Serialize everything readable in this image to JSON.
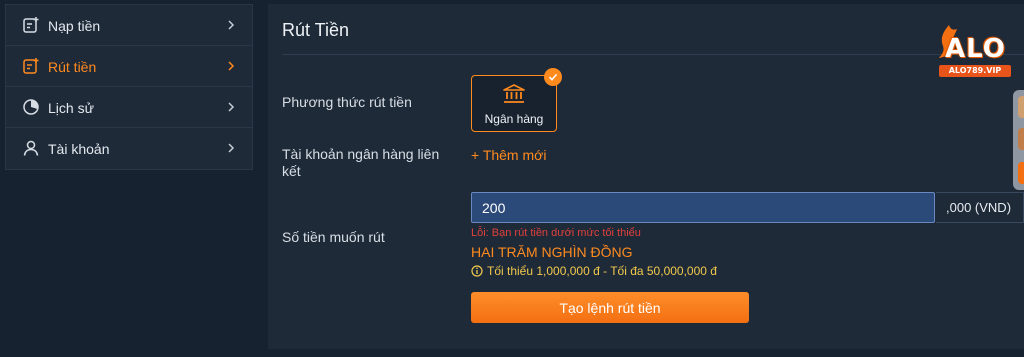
{
  "sidebar": {
    "items": [
      {
        "label": "Nạp tiền",
        "icon": "deposit-icon",
        "active": false
      },
      {
        "label": "Rút tiền",
        "icon": "withdraw-icon",
        "active": true
      },
      {
        "label": "Lịch sử",
        "icon": "history-icon",
        "active": false
      },
      {
        "label": "Tài khoản",
        "icon": "user-icon",
        "active": false
      }
    ]
  },
  "page": {
    "title": "Rút Tiền"
  },
  "form": {
    "method_label": "Phương thức rút tiền",
    "method_option": "Ngân hàng",
    "linked_account_label_1": "Tài khoản ngân hàng liên",
    "linked_account_label_2": "kết",
    "add_new": "+ Thêm mới",
    "amount_label": "Số tiền muốn rút",
    "amount_value": "200",
    "amount_suffix": ",000 (VND)",
    "error_text": "Lỗi: Bạn rút tiền dưới mức tối thiểu",
    "amount_in_words": "HAI TRĂM NGHÌN ĐỒNG",
    "limits_text": "Tối thiểu 1,000,000 đ - Tối đa 50,000,000 đ",
    "submit_label": "Tạo lệnh rút tiền"
  },
  "logo": {
    "name": "ALO",
    "site": "ALO789.VIP"
  },
  "colors": {
    "accent": "#ff8a1e",
    "error": "#e0413b",
    "warning": "#f2c94c",
    "panel": "#1e2a38",
    "input": "#2b4a7a"
  }
}
